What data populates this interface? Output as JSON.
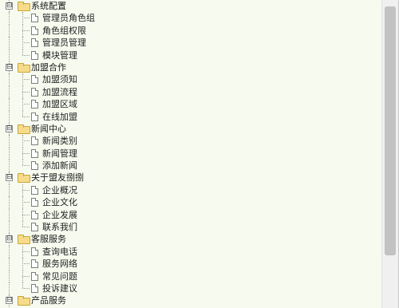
{
  "tree": {
    "groups": [
      {
        "label": "系统配置",
        "items": [
          "管理员角色组",
          "角色组权限",
          "管理员管理",
          "模块管理"
        ]
      },
      {
        "label": "加盟合作",
        "items": [
          "加盟须知",
          "加盟流程",
          "加盟区域",
          "在线加盟"
        ]
      },
      {
        "label": "新闻中心",
        "items": [
          "新闻类别",
          "新闻管理",
          "添加新闻"
        ]
      },
      {
        "label": "关于盟友捌捌",
        "items": [
          "企业概况",
          "企业文化",
          "企业发展",
          "联系我们"
        ]
      },
      {
        "label": "客服服务",
        "items": [
          "查询电话",
          "服务网络",
          "常见问题",
          "投诉建议"
        ]
      },
      {
        "label": "产品服务",
        "items": []
      }
    ],
    "toggle_symbol": "⊟"
  }
}
